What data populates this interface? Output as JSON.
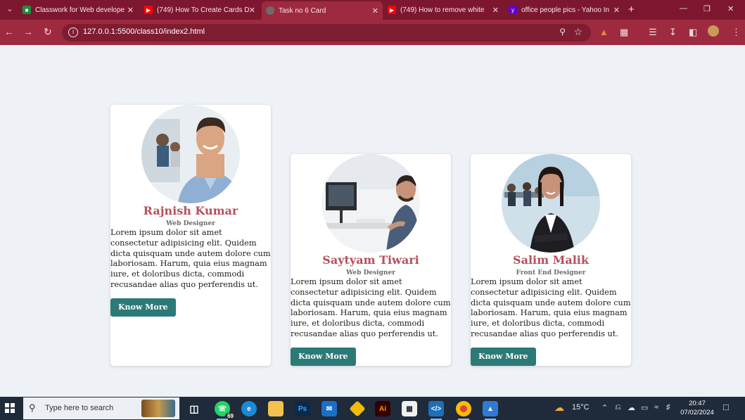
{
  "browser": {
    "tabs": [
      {
        "title": "Classwork for Web develope",
        "favicon": "classroom-icon",
        "color": "#1e8e3e"
      },
      {
        "title": "(749) How To Create Cards D",
        "favicon": "youtube-icon",
        "color": "#ff0000"
      },
      {
        "title": "Task no 6 Card",
        "favicon": "globe-icon",
        "color": "#6b6b6b"
      },
      {
        "title": "(749) How to remove white",
        "favicon": "youtube-icon",
        "color": "#ff0000"
      },
      {
        "title": "office people pics - Yahoo In",
        "favicon": "yahoo-icon",
        "color": "#6001d2"
      }
    ],
    "active_tab": 2,
    "url": "127.0.0.1:5500/class10/index2.html",
    "theme_color": "#9e2a3f"
  },
  "cards": [
    {
      "name": "Rajnish Kumar",
      "role": "Web Designer",
      "description": "Lorem ipsum dolor sit amet consectetur adipisicing elit. Quidem dicta quisquam unde autem dolore cum laboriosam. Harum, quia eius magnam iure, et doloribus dicta, commodi recusandae alias quo perferendis ut.",
      "button": "Know More"
    },
    {
      "name": "Saytyam Tiwari",
      "role": "Web Designer",
      "description": "Lorem ipsum dolor sit amet consectetur adipisicing elit. Quidem dicta quisquam unde autem dolore cum laboriosam. Harum, quia eius magnam iure, et doloribus dicta, commodi recusandae alias quo perferendis ut.",
      "button": "Know More"
    },
    {
      "name": "Salim Malik",
      "role": "Front End Designer",
      "description": "Lorem ipsum dolor sit amet consectetur adipisicing elit. Quidem dicta quisquam unde autem dolore cum laboriosam. Harum, quia eius magnam iure, et doloribus dicta, commodi recusandae alias quo perferendis ut.",
      "button": "Know More"
    }
  ],
  "colors": {
    "name": "#b5505a",
    "button": "#2c7a78",
    "page_bg": "#eef1f6"
  },
  "taskbar": {
    "search_placeholder": "Type here to search",
    "whatsapp_badge": "69",
    "weather": "15°C",
    "time": "20:47",
    "date": "07/02/2024"
  }
}
